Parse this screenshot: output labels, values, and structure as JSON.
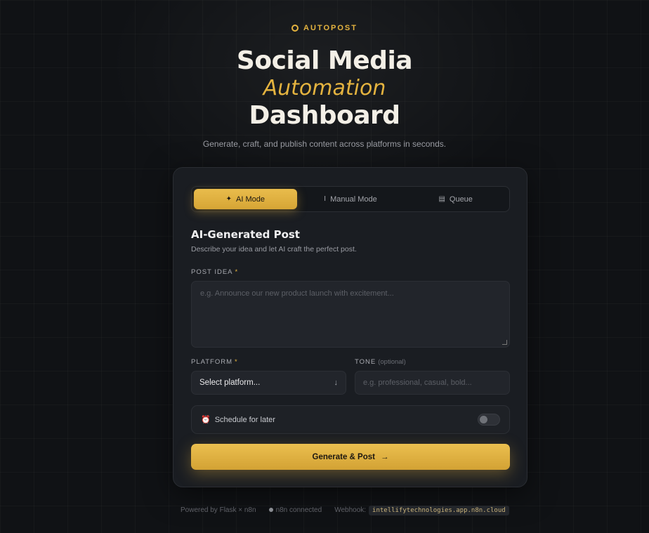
{
  "brand": {
    "name": "AUTOPOST",
    "accent": "#e4b33f"
  },
  "hero": {
    "line1": "Social Media",
    "line2": "Automation",
    "line3": "Dashboard",
    "subtitle": "Generate, craft, and publish content across platforms in seconds."
  },
  "tabs": [
    {
      "icon": "✦",
      "label": "AI Mode",
      "active": true
    },
    {
      "icon": "I",
      "label": "Manual Mode",
      "active": false
    },
    {
      "icon": "▤",
      "label": "Queue",
      "active": false
    }
  ],
  "section": {
    "title": "AI-Generated Post",
    "description": "Describe your idea and let AI craft the perfect post."
  },
  "form": {
    "post_idea": {
      "label": "POST IDEA",
      "required": "*",
      "placeholder": "e.g. Announce our new product launch with excitement..."
    },
    "platform": {
      "label": "PLATFORM",
      "required": "*",
      "value": "Select platform...",
      "arrow": "↓"
    },
    "tone": {
      "label": "TONE",
      "optional": "(optional)",
      "placeholder": "e.g. professional, casual, bold..."
    },
    "schedule": {
      "icon": "⏰",
      "label": "Schedule for later",
      "enabled": false
    }
  },
  "generate_button": {
    "label": "Generate & Post",
    "arrow": "→"
  },
  "footer": {
    "powered_by": "Powered by Flask × n8n",
    "status": "n8n connected",
    "webhook_label": "Webhook:",
    "webhook_host": "intellifytechnologies.app.n8n.cloud"
  }
}
